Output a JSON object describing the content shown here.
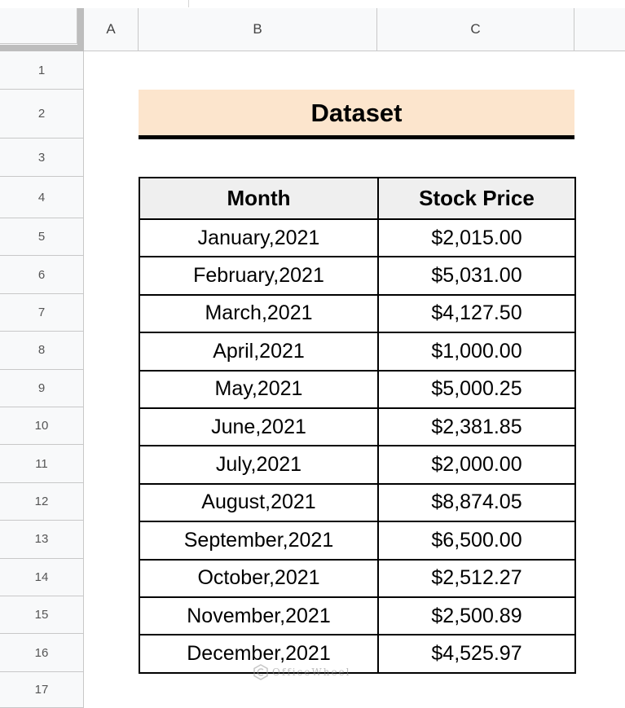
{
  "columns": [
    "A",
    "B",
    "C"
  ],
  "rows": [
    "1",
    "2",
    "3",
    "4",
    "5",
    "6",
    "7",
    "8",
    "9",
    "10",
    "11",
    "12",
    "13",
    "14",
    "15",
    "16",
    "17"
  ],
  "sheet": {
    "title": "Dataset",
    "title_bg": "#fce5cd",
    "table": {
      "headers": [
        "Month",
        "Stock Price"
      ],
      "rows": [
        [
          "January,2021",
          "$2,015.00"
        ],
        [
          "February,2021",
          "$5,031.00"
        ],
        [
          "March,2021",
          "$4,127.50"
        ],
        [
          "April,2021",
          "$1,000.00"
        ],
        [
          "May,2021",
          "$5,000.25"
        ],
        [
          "June,2021",
          "$2,381.85"
        ],
        [
          "July,2021",
          "$2,000.00"
        ],
        [
          "August,2021",
          "$8,874.05"
        ],
        [
          "September,2021",
          "$6,500.00"
        ],
        [
          "October,2021",
          "$2,512.27"
        ],
        [
          "November,2021",
          "$2,500.89"
        ],
        [
          "December,2021",
          "$4,525.97"
        ]
      ]
    }
  },
  "watermark": "OfficeWheel"
}
